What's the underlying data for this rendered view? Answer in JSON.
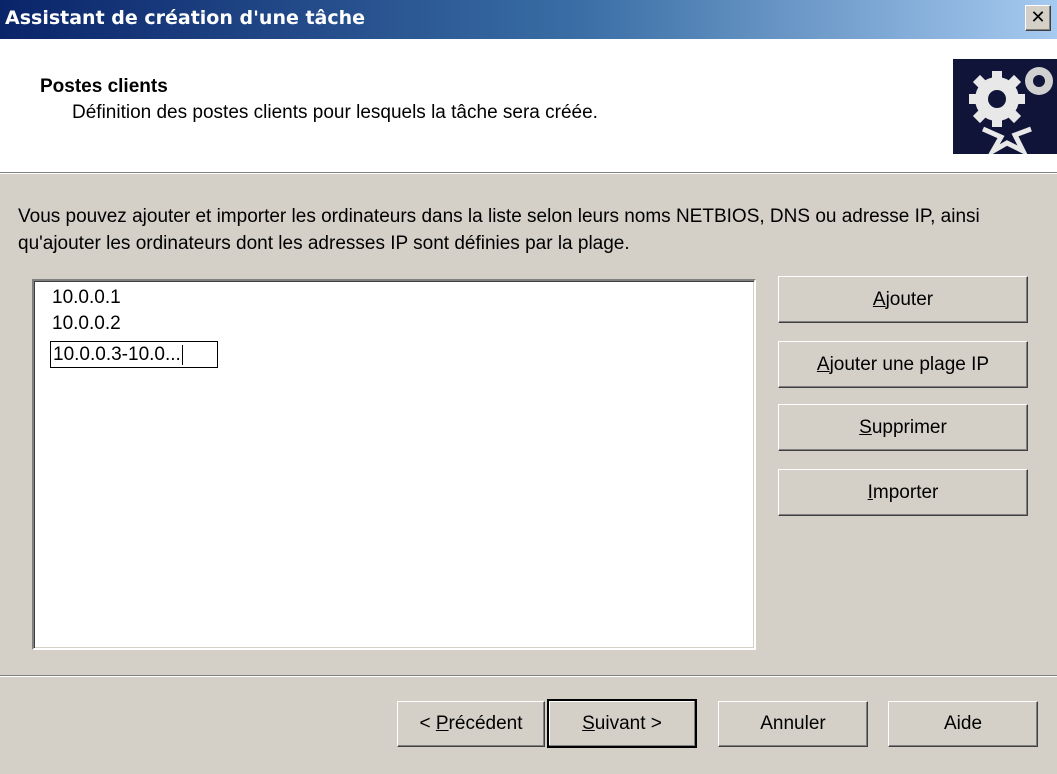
{
  "window": {
    "title": "Assistant de création d'une tâche",
    "close_label": "✕"
  },
  "header": {
    "title": "Postes clients",
    "subtitle": "Définition des postes clients pour lesquels la tâche sera créée.",
    "icon": "gears-icon"
  },
  "description": "Vous pouvez ajouter et importer les ordinateurs dans la liste selon leurs noms NETBIOS, DNS ou adresse IP, ainsi qu'ajouter les ordinateurs dont les adresses IP sont définies par la plage.",
  "client_list": {
    "items": [
      "10.0.0.1",
      "10.0.0.2"
    ],
    "editing_value": "10.0.0.3-10.0..."
  },
  "side_buttons": {
    "add": {
      "mnemonic": "A",
      "rest": "jouter"
    },
    "add_range": {
      "mnemonic": "A",
      "rest": "jouter une plage IP"
    },
    "delete": {
      "mnemonic": "S",
      "rest": "upprimer"
    },
    "import": {
      "mnemonic": "I",
      "rest": "mporter"
    }
  },
  "footer_buttons": {
    "back": {
      "prefix": "< ",
      "mnemonic": "P",
      "rest": "récédent"
    },
    "next": {
      "mnemonic": "S",
      "rest": "uivant >"
    },
    "cancel": "Annuler",
    "help": "Aide"
  },
  "colors": {
    "titlebar_start": "#0a246a",
    "titlebar_end": "#a6caf0",
    "dialog_bg": "#d4d0c8",
    "header_icon_bg": "#101438"
  }
}
